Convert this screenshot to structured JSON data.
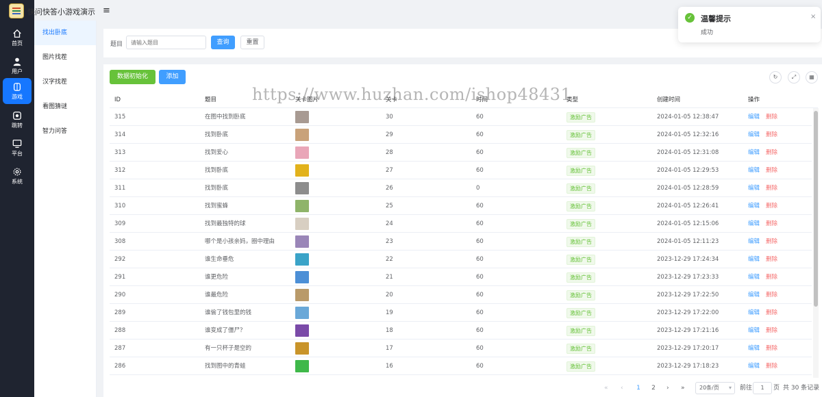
{
  "app": {
    "title": "快问快答小游戏演示",
    "menu_icon": "hamburger-icon"
  },
  "rail": [
    {
      "label": "首页",
      "icon": "home-icon"
    },
    {
      "label": "用户",
      "icon": "user-icon"
    },
    {
      "label": "游戏",
      "icon": "gamepad-icon",
      "active": true
    },
    {
      "label": "跳转",
      "icon": "jump-icon"
    },
    {
      "label": "平台",
      "icon": "monitor-icon"
    },
    {
      "label": "系统",
      "icon": "gear-icon"
    }
  ],
  "submenu": [
    {
      "label": "找出卧底",
      "active": true
    },
    {
      "label": "图片找茬"
    },
    {
      "label": "汉字找茬"
    },
    {
      "label": "看图猜谜"
    },
    {
      "label": "智力问答"
    }
  ],
  "search": {
    "label": "题目",
    "placeholder": "请输入题目",
    "query_label": "查询",
    "reset_label": "重置"
  },
  "toolbar": {
    "init_label": "数据初始化",
    "add_label": "添加",
    "refresh_icon": "refresh-icon",
    "fullscreen_icon": "fullscreen-icon",
    "columns_icon": "columns-icon"
  },
  "table": {
    "headers": [
      "ID",
      "题目",
      "关卡图片",
      "关卡",
      "时间",
      "类型",
      "创建时间",
      "操作"
    ],
    "edit_label": "编辑",
    "delete_label": "删除",
    "rows": [
      {
        "id": "315",
        "title": "在图中找到卧底",
        "level": "30",
        "time": "60",
        "type": "激励广告",
        "created": "2024-01-05 12:38:47",
        "thumb_color": "#a89a92"
      },
      {
        "id": "314",
        "title": "找到卧底",
        "level": "29",
        "time": "60",
        "type": "激励广告",
        "created": "2024-01-05 12:32:16",
        "thumb_color": "#c9a27a"
      },
      {
        "id": "313",
        "title": "找到爱心",
        "level": "28",
        "time": "60",
        "type": "激励广告",
        "created": "2024-01-05 12:31:08",
        "thumb_color": "#e9a6b8"
      },
      {
        "id": "312",
        "title": "找到卧底",
        "level": "27",
        "time": "60",
        "type": "激励广告",
        "created": "2024-01-05 12:29:53",
        "thumb_color": "#e2b21c"
      },
      {
        "id": "311",
        "title": "找到卧底",
        "level": "26",
        "time": "0",
        "type": "激励广告",
        "created": "2024-01-05 12:28:59",
        "thumb_color": "#8d8d8d"
      },
      {
        "id": "310",
        "title": "找到蜜蜂",
        "level": "25",
        "time": "60",
        "type": "激励广告",
        "created": "2024-01-05 12:26:41",
        "thumb_color": "#8fb46a"
      },
      {
        "id": "309",
        "title": "找到最独特的球",
        "level": "24",
        "time": "60",
        "type": "激励广告",
        "created": "2024-01-05 12:15:06",
        "thumb_color": "#d8cfc2"
      },
      {
        "id": "308",
        "title": "哪个是小孩亲妈，圈中理由",
        "level": "23",
        "time": "60",
        "type": "激励广告",
        "created": "2024-01-05 12:11:23",
        "thumb_color": "#9a86b8"
      },
      {
        "id": "292",
        "title": "谁生命垂危",
        "level": "22",
        "time": "60",
        "type": "激励广告",
        "created": "2023-12-29 17:24:34",
        "thumb_color": "#3aa3c8"
      },
      {
        "id": "291",
        "title": "谁更危险",
        "level": "21",
        "time": "60",
        "type": "激励广告",
        "created": "2023-12-29 17:23:33",
        "thumb_color": "#4c8fd6"
      },
      {
        "id": "290",
        "title": "谁最危险",
        "level": "20",
        "time": "60",
        "type": "激励广告",
        "created": "2023-12-29 17:22:50",
        "thumb_color": "#b99a6a"
      },
      {
        "id": "289",
        "title": "谁偷了钱包里的钱",
        "level": "19",
        "time": "60",
        "type": "激励广告",
        "created": "2023-12-29 17:22:00",
        "thumb_color": "#6aa8d8"
      },
      {
        "id": "288",
        "title": "谁变成了僵尸？",
        "level": "18",
        "time": "60",
        "type": "激励广告",
        "created": "2023-12-29 17:21:16",
        "thumb_color": "#7a4aa8"
      },
      {
        "id": "287",
        "title": "有一只杯子是空的",
        "level": "17",
        "time": "60",
        "type": "激励广告",
        "created": "2023-12-29 17:20:17",
        "thumb_color": "#c9942a"
      },
      {
        "id": "286",
        "title": "找到图中的青蛙",
        "level": "16",
        "time": "60",
        "type": "激励广告",
        "created": "2023-12-29 17:18:23",
        "thumb_color": "#3fb84a"
      }
    ]
  },
  "pagination": {
    "pages": [
      "1",
      "2"
    ],
    "current": "1",
    "page_size": "20条/页",
    "goto_label": "前往",
    "goto_value": "1",
    "page_unit": "页",
    "total": "共 30 条记录"
  },
  "notification": {
    "title": "温馨提示",
    "message": "成功"
  },
  "watermark": "https://www.huzhan.com/ishop48431"
}
